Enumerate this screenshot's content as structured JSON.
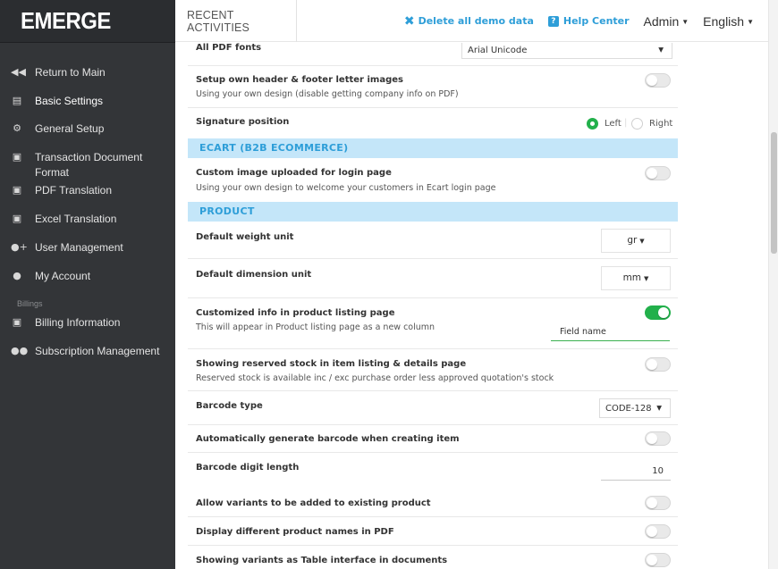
{
  "app": {
    "logo": "EMERGE"
  },
  "sidebar": {
    "items": [
      {
        "icon": "chevron-double-left-icon",
        "label": "Return to Main"
      },
      {
        "icon": "document-icon",
        "label": "Basic Settings"
      },
      {
        "icon": "gear-icon",
        "label": "General Setup"
      },
      {
        "icon": "file-icon",
        "label": "Transaction Document Format"
      },
      {
        "icon": "file-icon",
        "label": "PDF Translation"
      },
      {
        "icon": "file-icon",
        "label": "Excel Translation"
      },
      {
        "icon": "user-plus-icon",
        "label": "User Management"
      },
      {
        "icon": "user-icon",
        "label": "My Account"
      },
      {
        "icon": "file-icon",
        "label": "Billing Information"
      },
      {
        "icon": "users-icon",
        "label": "Subscription Management"
      }
    ],
    "group_label": "Billings"
  },
  "header": {
    "recent": "RECENT ACTIVITIES",
    "delete_demo": "Delete all demo data",
    "help": "Help Center",
    "user": "Admin",
    "language": "English"
  },
  "settings": {
    "pdf_fonts": {
      "title": "All PDF fonts",
      "value": "Arial Unicode"
    },
    "header_footer": {
      "title": "Setup own header & footer letter images",
      "desc": "Using your own design (disable getting company info on PDF)",
      "enabled": false
    },
    "signature": {
      "title": "Signature position",
      "left": "Left",
      "right": "Right",
      "selected": "Left"
    },
    "ecart_section": "ECART (B2B ECOMMERCE)",
    "login_image": {
      "title": "Custom image uploaded for login page",
      "desc": "Using your own design to welcome your customers in Ecart login page",
      "enabled": false
    },
    "product_section": "PRODUCT",
    "weight_unit": {
      "title": "Default weight unit",
      "value": "gr"
    },
    "dimension_unit": {
      "title": "Default dimension unit",
      "value": "mm"
    },
    "custom_info": {
      "title": "Customized info in product listing page",
      "desc": "This will appear in Product listing page as a new column",
      "enabled": true,
      "field_value": "Field name"
    },
    "reserved_stock": {
      "title": "Showing reserved stock in item listing & details page",
      "desc": "Reserved stock is available inc / exc purchase order less approved quotation's stock",
      "enabled": false
    },
    "barcode_type": {
      "title": "Barcode type",
      "value": "CODE-128"
    },
    "auto_barcode": {
      "title": "Automatically generate barcode when creating item",
      "enabled": false
    },
    "barcode_length": {
      "title": "Barcode digit length",
      "value": "10"
    },
    "allow_variants": {
      "title": "Allow variants to be added to existing product",
      "enabled": false
    },
    "diff_names": {
      "title": "Display different product names in PDF",
      "enabled": false
    },
    "variants_table": {
      "title": "Showing variants as Table interface in documents",
      "enabled": false
    }
  },
  "colors": {
    "accent": "#2e9ed8",
    "toggle_on": "#22b04b",
    "section_bg": "#c4e6f9",
    "sidebar_bg": "#333538"
  }
}
